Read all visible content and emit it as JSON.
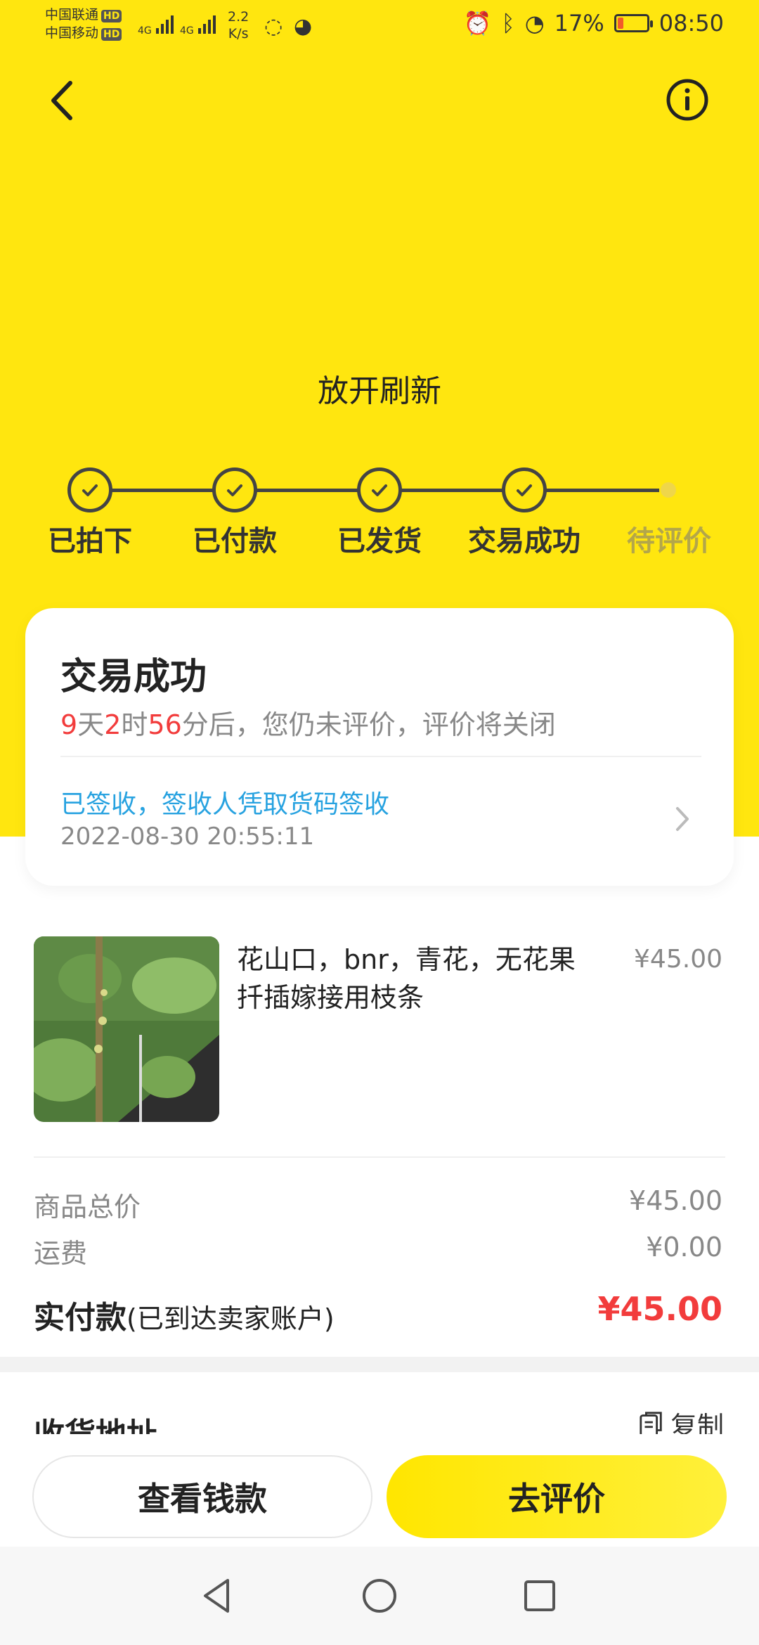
{
  "status_bar": {
    "carrier1": "中国联通",
    "carrier2": "中国移动",
    "hd": "HD",
    "network": "4G",
    "speed_value": "2.2",
    "speed_unit": "K/s",
    "battery_percent": "17%",
    "time": "08:50"
  },
  "header": {
    "refresh_text": "放开刷新"
  },
  "steps": [
    {
      "label": "已拍下",
      "done": true
    },
    {
      "label": "已付款",
      "done": true
    },
    {
      "label": "已发货",
      "done": true
    },
    {
      "label": "交易成功",
      "done": true
    },
    {
      "label": "待评价",
      "done": false
    }
  ],
  "status_card": {
    "title": "交易成功",
    "countdown_days": "9",
    "countdown_days_unit": "天",
    "countdown_hours": "2",
    "countdown_hours_unit": "时",
    "countdown_minutes": "56",
    "countdown_suffix": "分后，您仍未评价，评价将关闭",
    "logistics_text": "已签收，签收人凭取货码签收",
    "logistics_time": "2022-08-30 20:55:11"
  },
  "product": {
    "title": "花山口，bnr，青花，无花果扦插嫁接用枝条",
    "price": "¥45.00"
  },
  "fees": {
    "goods_total_label": "商品总价",
    "goods_total_value": "¥45.00",
    "shipping_label": "运费",
    "shipping_value": "¥0.00",
    "paid_label": "实付款",
    "paid_note": "(已到达卖家账户)",
    "paid_value": "¥45.00"
  },
  "address": {
    "title": "收货地址",
    "copy_label": "复制"
  },
  "actions": {
    "view_money": "查看钱款",
    "go_review": "去评价"
  },
  "colors": {
    "brand_yellow": "#ffe60f",
    "accent_red": "#f23c3c",
    "link_blue": "#27a2e0"
  }
}
